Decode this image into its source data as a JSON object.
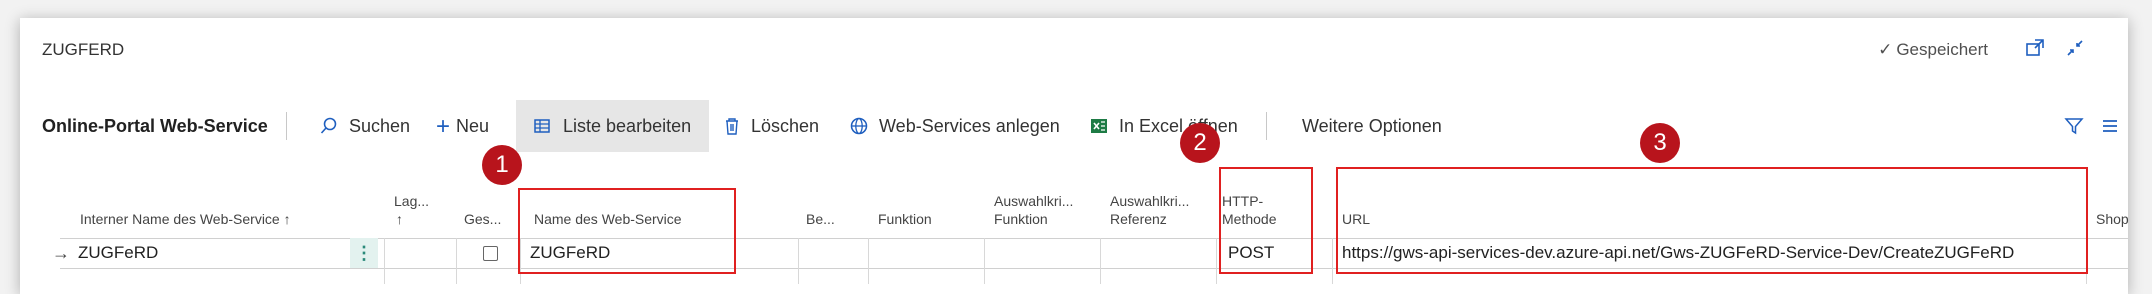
{
  "title_bar": {
    "title": "ZUGFERD",
    "status": "Gespeichert",
    "status_icon": "checkmark-icon",
    "icons": [
      "open-new-window-icon",
      "collapse-icon"
    ]
  },
  "action_bar": {
    "page_caption": "Online-Portal Web-Service",
    "search": "Suchen",
    "new": "Neu",
    "edit_list": "Liste bearbeiten",
    "delete": "Löschen",
    "create_web_services": "Web-Services anlegen",
    "open_in_excel": "In Excel öffnen",
    "more_options": "Weitere Optionen"
  },
  "table": {
    "headers": {
      "internal_name": "Interner Name des Web-Service ↑",
      "lag_1": "Lag...",
      "lag_2": "↑",
      "ges": "Ges...",
      "web_service_name": "Name des Web-Service",
      "be": "Be...",
      "funktion": "Funktion",
      "auswahl_funktion_1": "Auswahlkri...",
      "auswahl_funktion_2": "Funktion",
      "auswahl_referenz_1": "Auswahlkri...",
      "auswahl_referenz_2": "Referenz",
      "http_1": "HTTP-",
      "http_2": "Methode",
      "url": "URL",
      "shop": "Shop"
    },
    "rows": [
      {
        "row_marker": "→",
        "internal_name": "ZUGFeRD",
        "web_service_name": "ZUGFeRD",
        "http_method": "POST",
        "url": "https://gws-api-services-dev.azure-api.net/Gws-ZUGFeRD-Service-Dev/CreateZUGFeRD"
      }
    ]
  },
  "annotations": [
    "1",
    "2",
    "3"
  ],
  "colors": {
    "accent": "#1f5fbf",
    "callout_border": "#e02020",
    "callout_badge": "#b8141c",
    "excel_green": "#1e7b45"
  }
}
